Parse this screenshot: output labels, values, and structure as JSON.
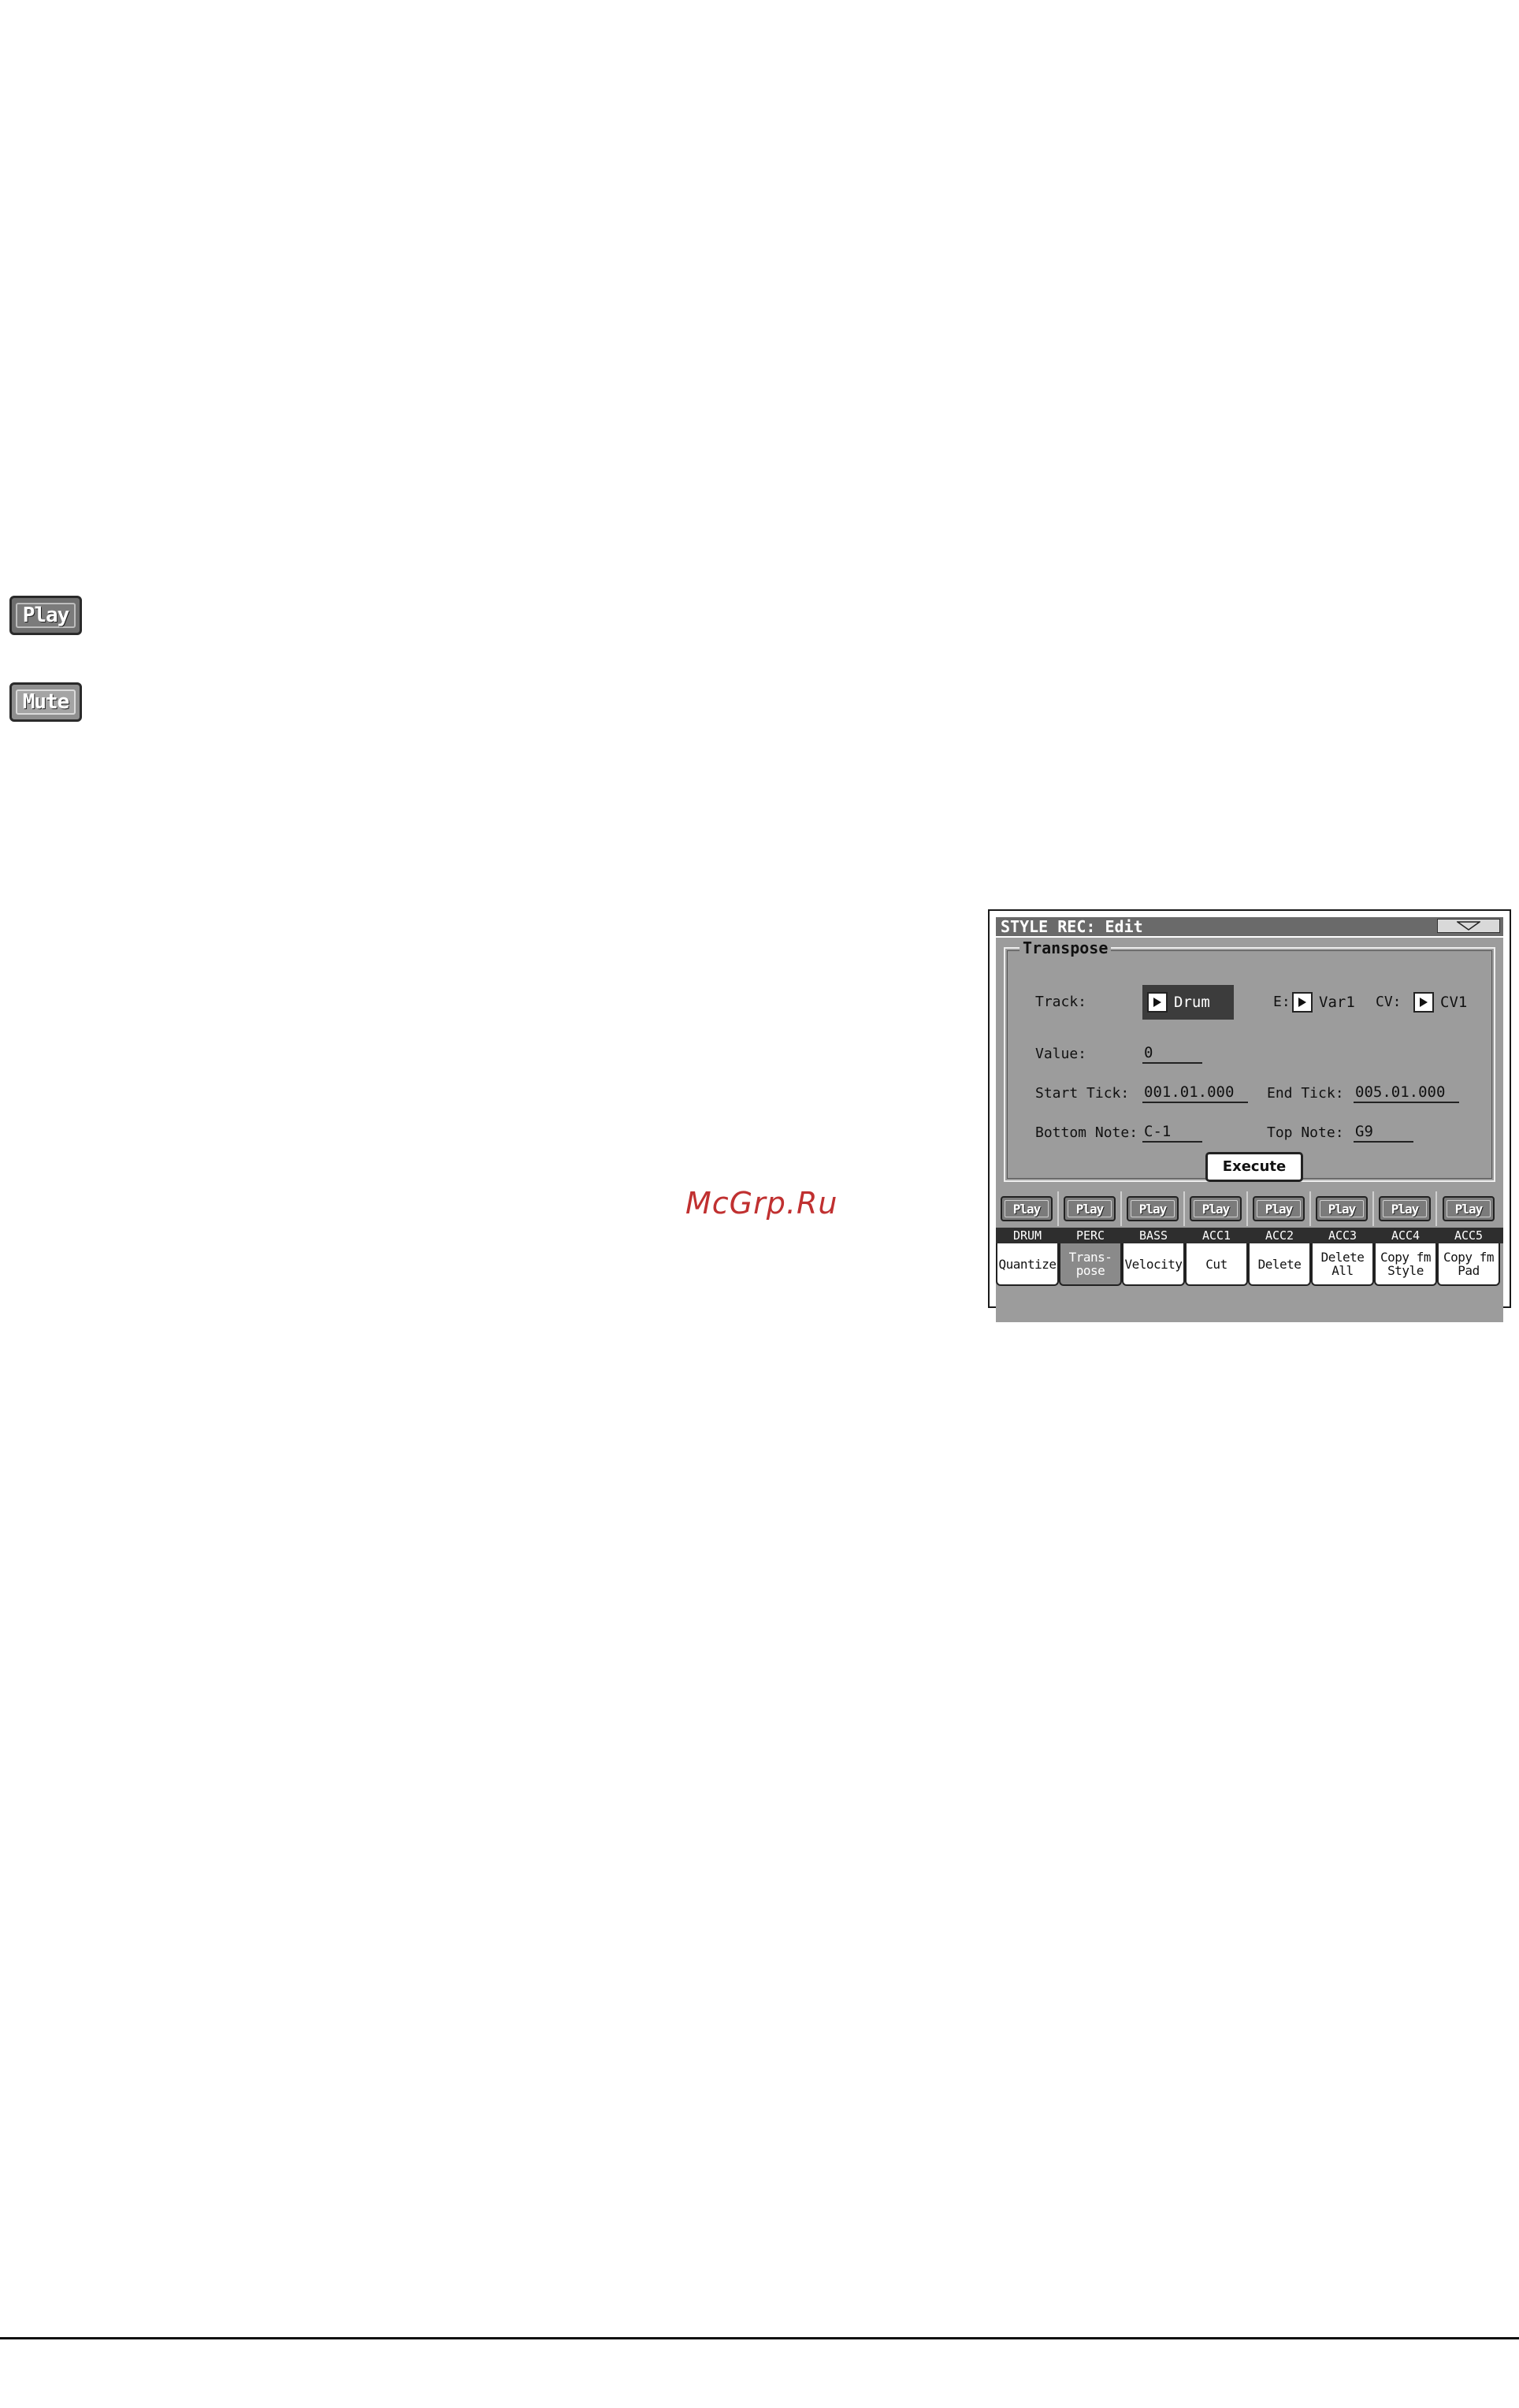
{
  "standalone_buttons": {
    "play_label": "Play",
    "mute_label": "Mute"
  },
  "watermark": "McGrp.Ru",
  "screen": {
    "title": "STYLE REC: Edit",
    "page_heading": "Transpose",
    "track": {
      "label": "Track:",
      "value": "Drum"
    },
    "element": {
      "label": "E:",
      "value": "Var1"
    },
    "chord_variation": {
      "label": "CV:",
      "value": "CV1"
    },
    "value": {
      "label": "Value:",
      "value": "0"
    },
    "start_tick": {
      "label": "Start Tick:",
      "value": "001.01.000"
    },
    "end_tick": {
      "label": "End Tick:",
      "value": "005.01.000"
    },
    "bottom_note": {
      "label": "Bottom Note:",
      "value": "C-1"
    },
    "top_note": {
      "label": "Top Note:",
      "value": "G9"
    },
    "execute_label": "Execute",
    "tracks": [
      {
        "name": "DRUM",
        "play": "Play"
      },
      {
        "name": "PERC",
        "play": "Play"
      },
      {
        "name": "BASS",
        "play": "Play"
      },
      {
        "name": "ACC1",
        "play": "Play"
      },
      {
        "name": "ACC2",
        "play": "Play"
      },
      {
        "name": "ACC3",
        "play": "Play"
      },
      {
        "name": "ACC4",
        "play": "Play"
      },
      {
        "name": "ACC5",
        "play": "Play"
      }
    ],
    "tabs": [
      {
        "label": "Quantize",
        "active": false
      },
      {
        "label": "Trans-\npose",
        "active": true
      },
      {
        "label": "Velocity",
        "active": false
      },
      {
        "label": "Cut",
        "active": false
      },
      {
        "label": "Delete",
        "active": false
      },
      {
        "label": "Delete\nAll",
        "active": false
      },
      {
        "label": "Copy fm\nStyle",
        "active": false
      },
      {
        "label": "Copy fm\nPad",
        "active": false
      }
    ]
  }
}
